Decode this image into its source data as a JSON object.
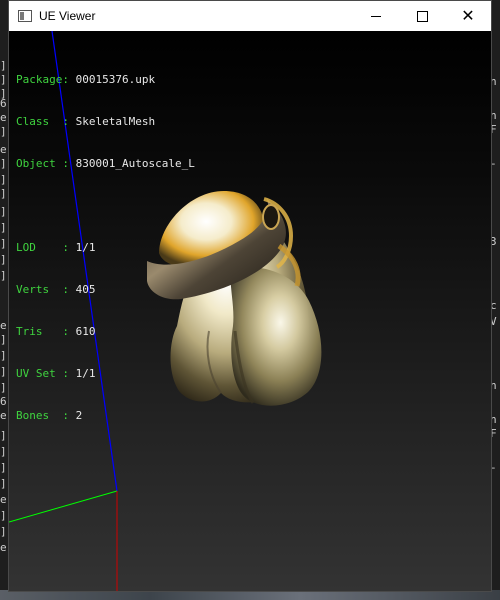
{
  "window": {
    "title": "UE Viewer",
    "controls": {
      "minimize": "—",
      "maximize": "□",
      "close": "✕"
    }
  },
  "info": {
    "package_label": "Package:",
    "package_value": "00015376.upk",
    "class_label": "Class  :",
    "class_value": "SkeletalMesh",
    "object_label": "Object :",
    "object_value": "830001_Autoscale_L",
    "lod_label": "LOD    :",
    "lod_value": "1/1",
    "verts_label": "Verts  :",
    "verts_value": "405",
    "tris_label": "Tris   :",
    "tris_value": "610",
    "uvset_label": "UV Set :",
    "uvset_value": "1/1",
    "bones_label": "Bones  :",
    "bones_value": "2"
  },
  "colors": {
    "label_green": "#3fd43f",
    "value_white": "#e8e8e8",
    "axis_x": "#00ff00",
    "axis_y": "#ff0000",
    "axis_z": "#0000ff"
  },
  "background_fragments": {
    "left": [
      "]",
      "]",
      "]",
      "6",
      "e",
      "]",
      "e",
      "]",
      "]",
      "]",
      "]",
      "]",
      "]",
      "]",
      "]",
      "e",
      "]",
      "]",
      "]",
      "]",
      "6",
      "e",
      "]",
      "]",
      "]",
      "]",
      "e",
      "]",
      "]",
      "e"
    ],
    "right": [
      "n",
      "n",
      "F",
      "-",
      "3",
      "c",
      "V",
      "n",
      "n",
      "F",
      "-"
    ]
  }
}
